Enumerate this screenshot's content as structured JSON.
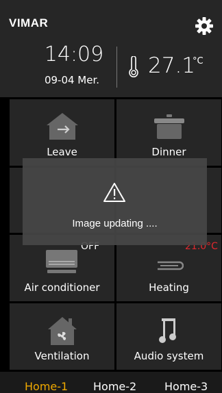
{
  "header": {
    "brand": "VIMAR",
    "time": "14:09",
    "date": "09-04  Mer.",
    "temperature": "27.1",
    "temperature_unit": "°C"
  },
  "tiles": {
    "leave": {
      "label": "Leave"
    },
    "dinner": {
      "label": "Dinner"
    },
    "air_conditioner": {
      "label": "Air conditioner",
      "status": "OFF"
    },
    "heating": {
      "label": "Heating",
      "status": "21.0°C"
    },
    "ventilation": {
      "label": "Ventilation"
    },
    "audio_system": {
      "label": "Audio system"
    }
  },
  "footer": {
    "tabs": [
      "Home-1",
      "Home-2",
      "Home-3"
    ],
    "active_tab": "Home-1"
  },
  "overlay": {
    "message": "Image updating ...."
  },
  "colors": {
    "accent": "#f0a900",
    "heating_status": "#e0282e",
    "tile_bg": "#262626"
  }
}
